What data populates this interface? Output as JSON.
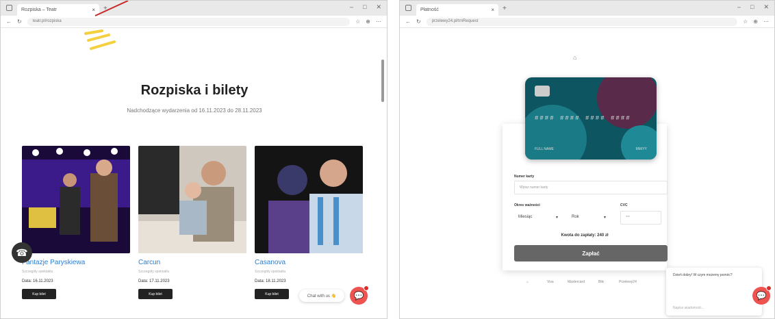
{
  "left": {
    "tab_title": "Rozpiska – Teatr",
    "url": "teatr.pl/rozpiska",
    "heading": "Rozpiska i bilety",
    "subheading": "Nadchodzące wydarzenia od 16.11.2023 do 28.11.2023",
    "events": [
      {
        "name": "Fantazje Paryskiewa",
        "desc": "Szczegóły spektaklu",
        "date": "Data: 16.11.2023",
        "button": "Kup bilet"
      },
      {
        "name": "Carcun",
        "desc": "Szczegóły spektaklu",
        "date": "Data: 17.11.2023",
        "button": "Kup bilet"
      },
      {
        "name": "Casanova",
        "desc": "Szczegóły spektaklu",
        "date": "Data: 18.11.2023",
        "button": "Kup bilet"
      }
    ],
    "chat_pill": "Chat with us 👋"
  },
  "right": {
    "tab_title": "Płatność",
    "url": "przelewy24.pl/trnRequest",
    "card": {
      "number": "#### #### #### ####",
      "holder": "FULL NAME",
      "expiry": "MM/YY"
    },
    "card_number_label": "Numer karty",
    "card_number_placeholder": "Wpisz numer karty",
    "expiry_label": "Okres ważności",
    "month_value": "Miesiąc",
    "year_value": "Rok",
    "cvc_label": "CVC",
    "cvc_value": "***",
    "total": "Kwota do zapłaty: 240 zł",
    "pay_button": "Zapłać",
    "logos": [
      "Visa",
      "Mastercard",
      "Blik",
      "Przelewy24"
    ],
    "chat_message": "Dzień dobry! W czym możemy pomóc?",
    "chat_input": "Napisz wiadomość..."
  },
  "colors": {
    "link": "#2a7fd4",
    "dark_button": "#222222",
    "chat_red": "#ef5350",
    "pay_button": "#666666"
  }
}
